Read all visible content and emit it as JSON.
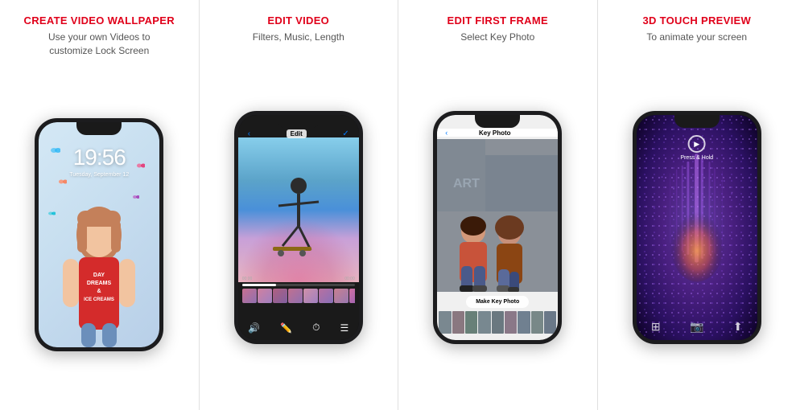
{
  "panels": [
    {
      "id": "panel-1",
      "title": "CREATE VIDEO WALLPAPER",
      "subtitle": "Use your own Videos to\ncustomize Lock Screen",
      "phone": {
        "time": "19:56",
        "date": "Tuesday, September 12"
      }
    },
    {
      "id": "panel-2",
      "title": "EDIT VIDEO",
      "subtitle": "Filters, Music, Length",
      "phone": {
        "header_label": "Edit",
        "time_start": "00:00",
        "time_end": "00:00"
      }
    },
    {
      "id": "panel-3",
      "title": "EDIT FIRST FRAME",
      "subtitle": "Select Key Photo",
      "phone": {
        "header_label": "Key Photo",
        "btn_label": "Make Key Photo"
      }
    },
    {
      "id": "panel-4",
      "title": "3D TOUCH PREVIEW",
      "subtitle": "To animate your screen",
      "phone": {
        "overlay_label": "Press & Hold"
      }
    }
  ]
}
